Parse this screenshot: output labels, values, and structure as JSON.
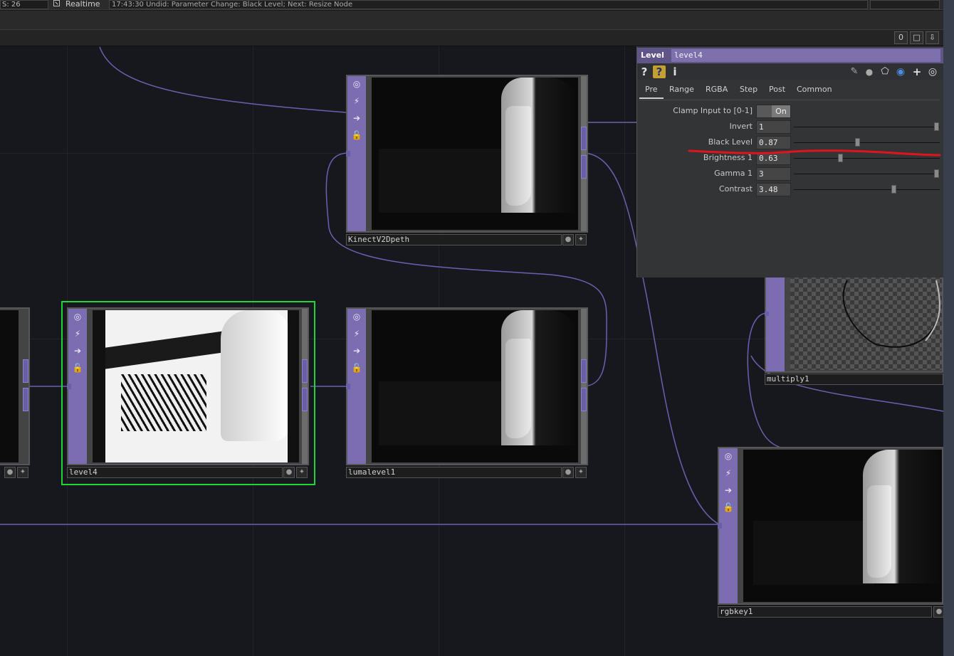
{
  "topbar": {
    "fps": "S: 26",
    "realtime_label": "Realtime",
    "status": "17:43:30 Undid: Parameter Change: Black Level; Next: Resize Node"
  },
  "path_buttons": [
    "0",
    "□",
    "⇩"
  ],
  "nodes": {
    "kinect": {
      "name": "KinectV2Dpeth"
    },
    "level4": {
      "name": "level4"
    },
    "lumalevel": {
      "name": "lumalevel1"
    },
    "multiply": {
      "name": "multiply1"
    },
    "rgbkey": {
      "name": "rgbkey1"
    }
  },
  "param_panel": {
    "type_label": "Level",
    "op_name": "level4",
    "icons": [
      "help-icon",
      "python-help-icon",
      "info-icon",
      "edit-icon",
      "comment-icon",
      "clone-icon",
      "python-icon",
      "add-icon",
      "target-icon"
    ],
    "tabs": [
      "Pre",
      "Range",
      "RGBA",
      "Step",
      "Post",
      "Common"
    ],
    "active_tab": "Pre",
    "params": [
      {
        "label": "Clamp Input to [0-1]",
        "value": "On",
        "kind": "toggle"
      },
      {
        "label": "Invert",
        "value": "1",
        "kind": "slider",
        "level": 1.0
      },
      {
        "label": "Black Level",
        "value": "0.87",
        "kind": "slider",
        "level": 0.435
      },
      {
        "label": "Brightness 1",
        "value": "0.63",
        "kind": "slider",
        "level": 0.315
      },
      {
        "label": "Gamma 1",
        "value": "3",
        "kind": "slider",
        "level": 1.0
      },
      {
        "label": "Contrast",
        "value": "3.48",
        "kind": "slider",
        "level": 0.696
      }
    ]
  },
  "colors": {
    "wire": "#6b5fb0",
    "node_strip": "#7c6db0",
    "selection": "#22d43a",
    "annotation": "#e0141e"
  }
}
